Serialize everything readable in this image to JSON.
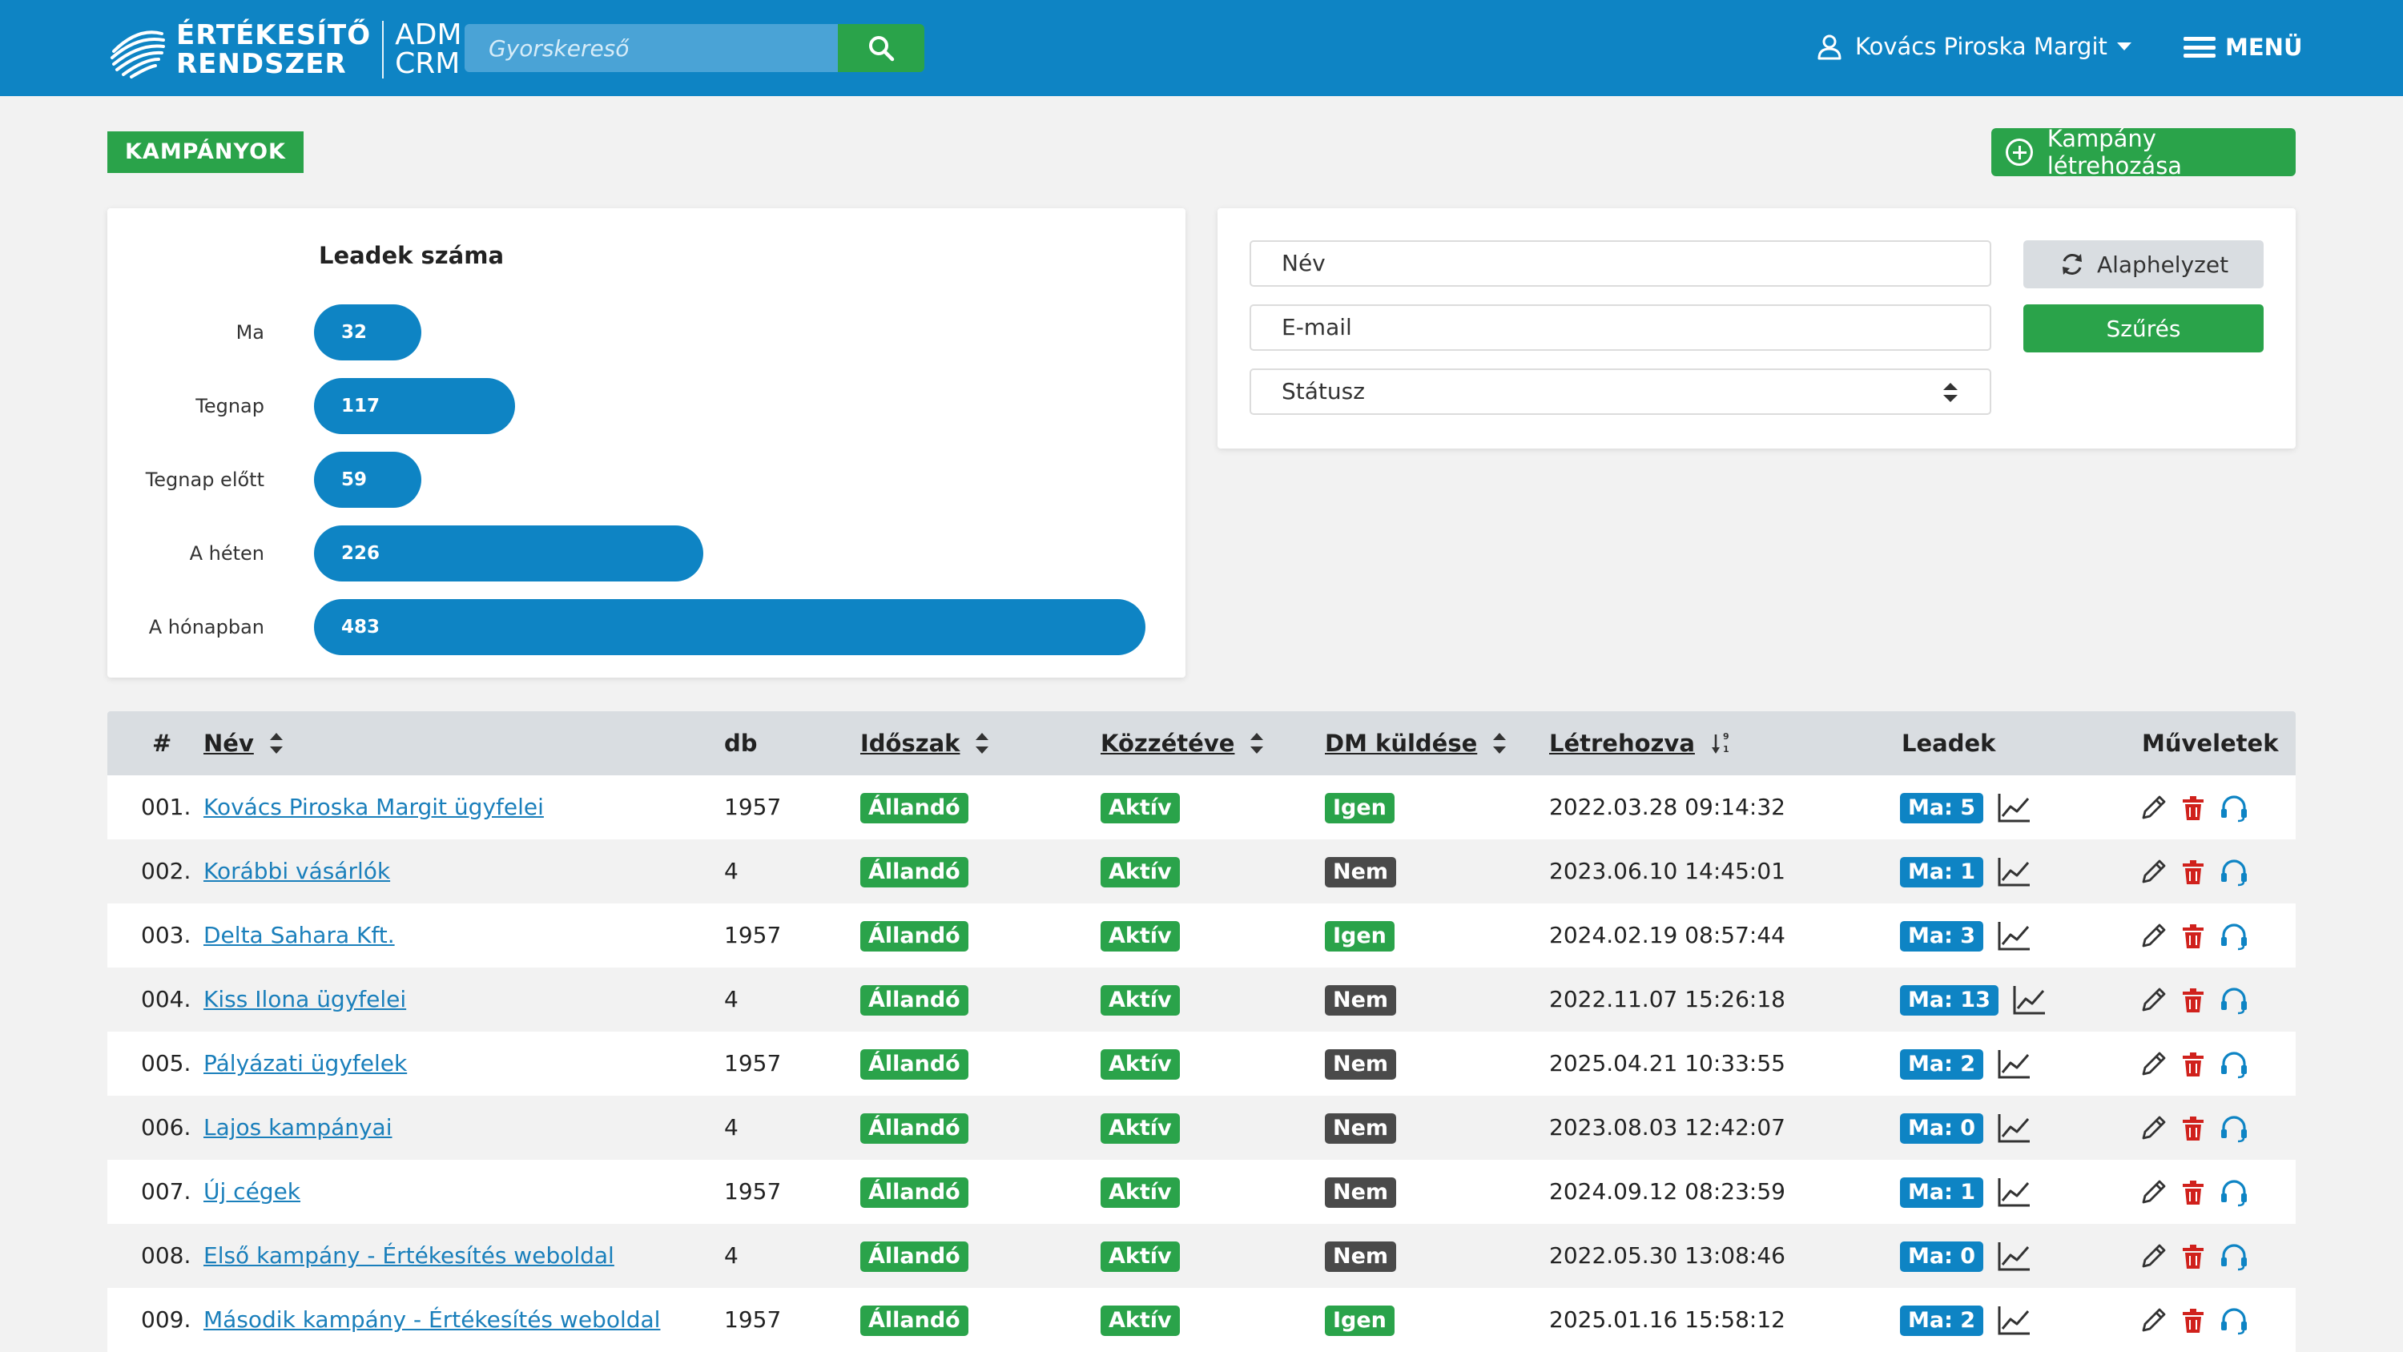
{
  "header": {
    "logo_line1": "ÉRTÉKESÍTŐ",
    "logo_line2": "RENDSZER",
    "logo_sub1": "ADM",
    "logo_sub2": "CRM",
    "search_placeholder": "Gyorskereső",
    "user_name": "Kovács Piroska Margit",
    "menu_label": "MENÜ"
  },
  "page": {
    "title": "KAMPÁNYOK",
    "create_button": "Kampány létrehozása"
  },
  "chart_data": {
    "type": "bar",
    "orientation": "horizontal",
    "title": "Leadek száma",
    "categories": [
      "Ma",
      "Tegnap",
      "Tegnap előtt",
      "A héten",
      "A hónapban"
    ],
    "values": [
      32,
      117,
      59,
      226,
      483
    ],
    "data_labels": [
      "32",
      "117",
      "59",
      "226",
      "483"
    ],
    "xlim": [
      0,
      483
    ],
    "grid": false,
    "color": "#0e84c4"
  },
  "filters": {
    "name_placeholder": "Név",
    "email_placeholder": "E-mail",
    "status_placeholder": "Státusz",
    "reset_label": "Alaphelyzet",
    "filter_label": "Szűrés"
  },
  "table": {
    "headers": {
      "num": "#",
      "name": "Név",
      "db": "db",
      "period": "Időszak",
      "published": "Közzétéve",
      "dm": "DM küldése",
      "created": "Létrehozva",
      "leads": "Leadek",
      "actions": "Műveletek"
    },
    "rows": [
      {
        "num": "001.",
        "name": "Kovács Piroska Margit ügyfelei",
        "db": "1957",
        "period": "Állandó",
        "published": "Aktív",
        "dm": "Igen",
        "created": "2022.03.28 09:14:32",
        "leads": "Ma: 5"
      },
      {
        "num": "002.",
        "name": "Korábbi vásárlók",
        "db": "4",
        "period": "Állandó",
        "published": "Aktív",
        "dm": "Nem",
        "created": "2023.06.10 14:45:01",
        "leads": "Ma: 1"
      },
      {
        "num": "003.",
        "name": "Delta Sahara Kft.",
        "db": "1957",
        "period": "Állandó",
        "published": "Aktív",
        "dm": "Igen",
        "created": "2024.02.19 08:57:44",
        "leads": "Ma: 3"
      },
      {
        "num": "004.",
        "name": "Kiss Ilona ügyfelei",
        "db": "4",
        "period": "Állandó",
        "published": "Aktív",
        "dm": "Nem",
        "created": "2022.11.07 15:26:18",
        "leads": "Ma: 13"
      },
      {
        "num": "005.",
        "name": "Pályázati ügyfelek",
        "db": "1957",
        "period": "Állandó",
        "published": "Aktív",
        "dm": "Nem",
        "created": "2025.04.21 10:33:55",
        "leads": "Ma: 2"
      },
      {
        "num": "006.",
        "name": "Lajos kampányai",
        "db": "4",
        "period": "Állandó",
        "published": "Aktív",
        "dm": "Nem",
        "created": "2023.08.03 12:42:07",
        "leads": "Ma: 0"
      },
      {
        "num": "007.",
        "name": "Új cégek",
        "db": "1957",
        "period": "Állandó",
        "published": "Aktív",
        "dm": "Nem",
        "created": "2024.09.12 08:23:59",
        "leads": "Ma: 1"
      },
      {
        "num": "008.",
        "name": "Első kampány - Értékesítés weboldal",
        "db": "4",
        "period": "Állandó",
        "published": "Aktív",
        "dm": "Nem",
        "created": "2022.05.30 13:08:46",
        "leads": "Ma: 0"
      },
      {
        "num": "009.",
        "name": "Második kampány - Értékesítés weboldal",
        "db": "1957",
        "period": "Állandó",
        "published": "Aktív",
        "dm": "Igen",
        "created": "2025.01.16 15:58:12",
        "leads": "Ma: 2"
      }
    ]
  },
  "colors": {
    "brand_blue": "#0e84c4",
    "success_green": "#2aa34a",
    "neutral_dark": "#4a4a4a",
    "danger_red": "#d0211c"
  },
  "icons": [
    "logo-icon",
    "search-icon",
    "user-icon",
    "caret-down-icon",
    "hamburger-icon",
    "plus-circle-icon",
    "refresh-icon",
    "sort-icon",
    "sort-numeric-icon",
    "line-chart-icon",
    "edit-icon",
    "trash-icon",
    "headset-icon"
  ]
}
